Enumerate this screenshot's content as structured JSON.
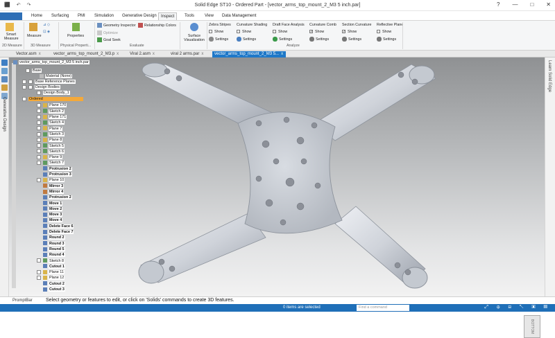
{
  "titlebar": {
    "title": "Solid Edge ST10 - Ordered Part - [vector_arms_top_mount_2_M3 5 inch.par]",
    "quick_access": [
      "⬛",
      "↶",
      "↷"
    ],
    "window_controls": [
      "?",
      "—",
      "□",
      "✕"
    ]
  },
  "ribbon_tabs": [
    "Home",
    "Surfacing",
    "PMI",
    "Simulation",
    "Generative Design",
    "Inspect",
    "Tools",
    "View",
    "Data Management"
  ],
  "active_tab": "Inspect",
  "ribbon": {
    "smart_measure": "Smart Measure",
    "measure": "Measure",
    "properties": "Properties",
    "geometry_inspector": "Geometry Inspector",
    "relationship_colors": "Relationship Colors",
    "optimize": "Optimize",
    "goal_seek": "Goal Seek",
    "surface_visualization": "Surface Visualization",
    "zebra": "Zebra Stripes",
    "curv_shading": "Curvature Shading",
    "draft_face": "Draft Face Analysis",
    "curv_comb": "Curvature Comb",
    "section_curv": "Section Curvature",
    "reflective": "Reflective Plane",
    "show": "Show",
    "settings": "Settings",
    "groups": {
      "measure2d": "2D Measure",
      "measure3d": "3D Measure",
      "physical": "Physical Properti...",
      "evaluate": "Evaluate",
      "analyze": "Analyze"
    }
  },
  "doc_tabs": [
    "Vector.asm",
    "vector_arms_top_mount_2_M3.p",
    "Viral 2.asm",
    "viral 2 arms.par",
    "vector_arms_top_mount_2_M3 5..."
  ],
  "doc_tab_close": "x",
  "left_panel_label": "Generative Design",
  "right_panel_label": "Learn Solid Edge",
  "tree": {
    "root": "vector_arms_top_mount_2_M3 5 inch.par",
    "base": "Base",
    "material": "Material (None)",
    "base_ref": "Base Reference Planes",
    "design_bodies": "Design Bodies",
    "design_body": "Design Body_1",
    "ordered": "Ordered",
    "features": [
      "Plane 170",
      "Sketch 2",
      "Plane 171",
      "Sketch 4",
      "Plane 7",
      "Sketch 3",
      "Plane 8",
      "Sketch 5",
      "Sketch 6",
      "Plane 9",
      "Sketch 7",
      "Protrusion 2",
      "Protrusion 3",
      "Plane 10",
      "Mirror 3",
      "Mirror 4",
      "Protrusion 2",
      "Move 1",
      "Move 2",
      "Move 3",
      "Move 4",
      "Delete Face 6",
      "Delete Face 7",
      "Round 2",
      "Round 3",
      "Round 5",
      "Round 4",
      "Sketch 8",
      "Cutout 1",
      "Plane 11",
      "Plane 12",
      "Cutout 2",
      "Cutout 3"
    ]
  },
  "viewcube_label": "BOTTOM",
  "prompt": {
    "label": "PromptBar",
    "text": "Select geometry or features to edit, or click on 'Solids' commands to create 3D features."
  },
  "status": {
    "items_selected": "0 items are selected",
    "find_placeholder": "Find a command",
    "icons": "⤢ ⊕ ⊟ ↖ ▣ ▤"
  },
  "colors": {
    "accent": "#1f78c8",
    "status_bar": "#1f6fb8",
    "tree_highlight": "#f4a93a"
  }
}
